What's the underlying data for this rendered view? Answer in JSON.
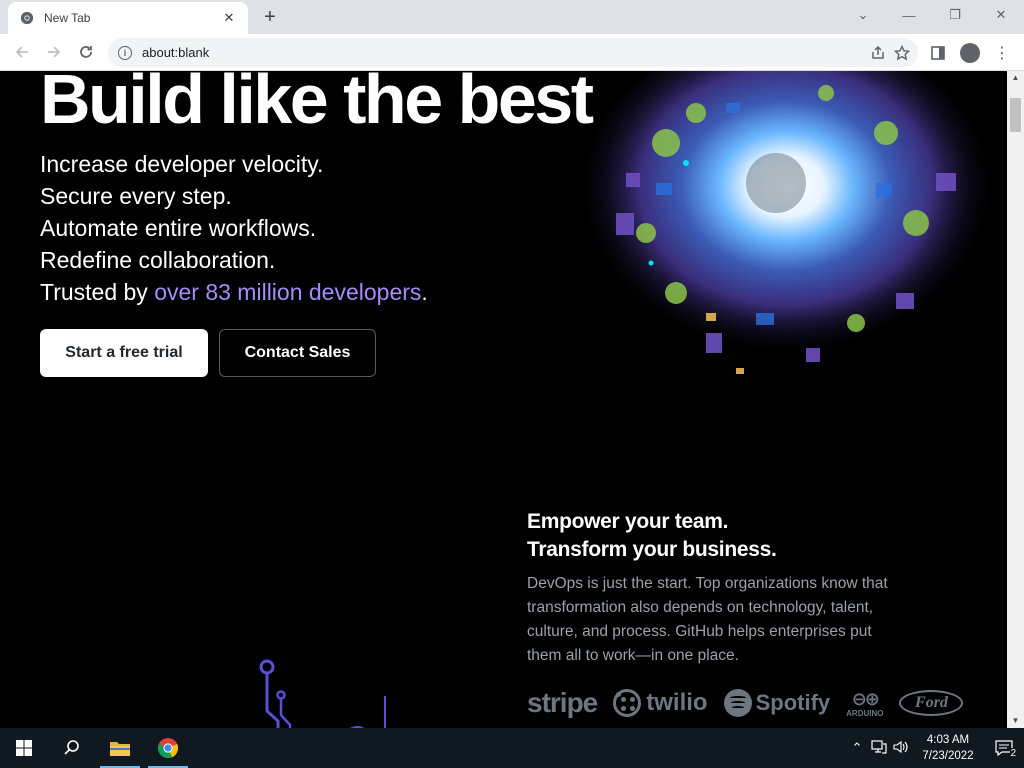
{
  "browser": {
    "tab_title": "New Tab",
    "url": "about:blank"
  },
  "hero": {
    "title": "Build like the best",
    "lines": [
      "Increase developer velocity.",
      "Secure every step.",
      "Automate entire workflows.",
      "Redefine collaboration."
    ],
    "trusted_prefix": "Trusted by ",
    "trusted_link": "over 83 million developers",
    "trusted_suffix": ".",
    "primary_button": "Start a free trial",
    "secondary_button": "Contact Sales"
  },
  "empower": {
    "heading_line1": "Empower your team.",
    "heading_line2": "Transform your business.",
    "paragraph": "DevOps is just the start. Top organizations know that transformation also depends on technology, talent, culture, and process. GitHub helps enterprises put them all to work—in one place."
  },
  "logos": {
    "stripe": "stripe",
    "twilio": "twilio",
    "spotify": "Spotify",
    "arduino": "ARDUINO",
    "ford": "Ford"
  },
  "taskbar": {
    "time": "4:03 AM",
    "date": "7/23/2022",
    "notification_count": "2"
  },
  "colors": {
    "accent_link": "#a78bfa",
    "page_bg": "#000000",
    "taskbar_bg": "#101820"
  }
}
